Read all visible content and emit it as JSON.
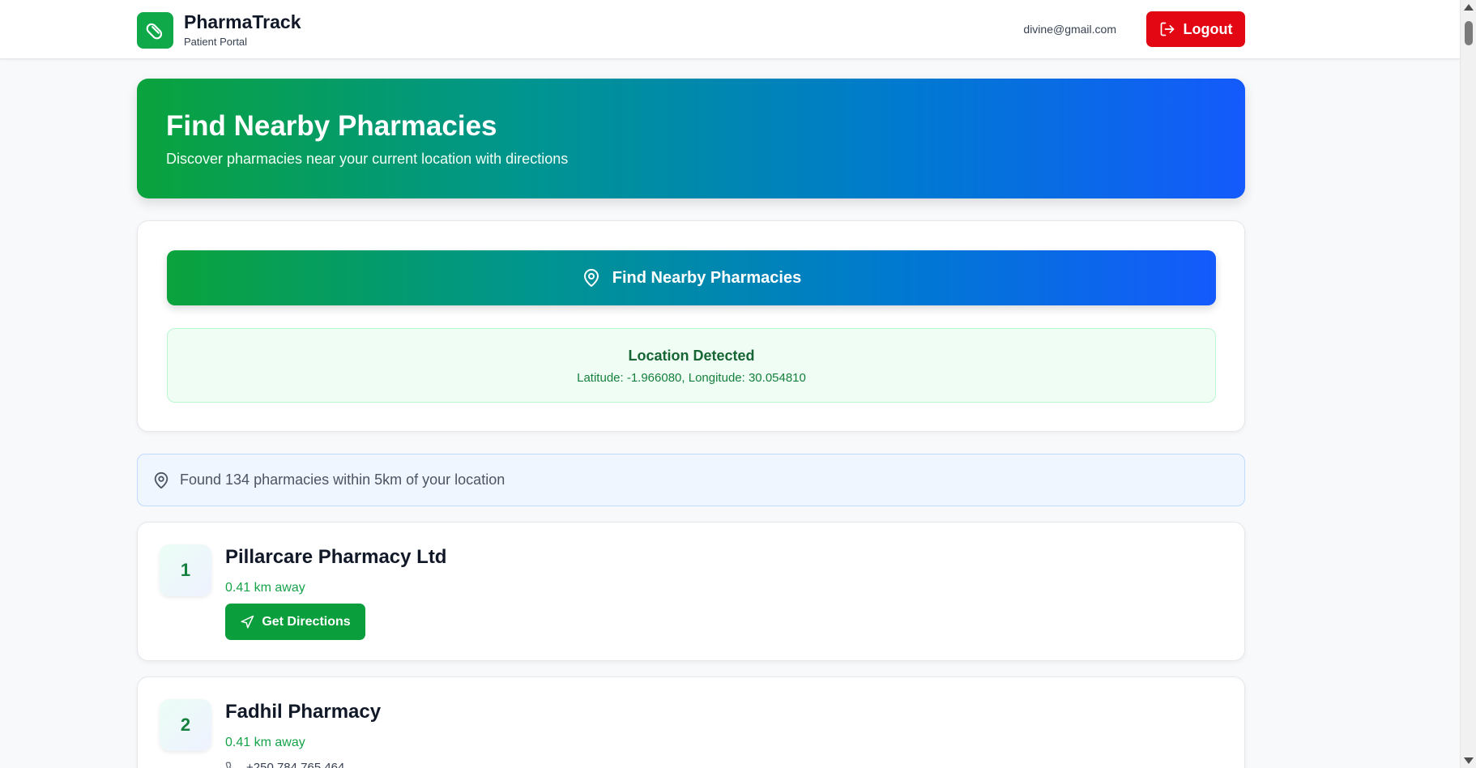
{
  "header": {
    "app_name": "PharmaTrack",
    "app_subtitle": "Patient Portal",
    "user_email": "divine@gmail.com",
    "logout_label": "Logout",
    "logo_icon": "pill-icon"
  },
  "hero": {
    "title": "Find Nearby Pharmacies",
    "subtitle": "Discover pharmacies near your current location with directions"
  },
  "finder": {
    "button_label": "Find Nearby Pharmacies",
    "location_title": "Location Detected",
    "location_coords": "Latitude: -1.966080, Longitude: 30.054810"
  },
  "results": {
    "summary": "Found 134 pharmacies within 5km of your location"
  },
  "pharmacies": [
    {
      "rank": "1",
      "name": "Pillarcare Pharmacy Ltd",
      "distance": "0.41 km away",
      "action_label": "Get Directions"
    },
    {
      "rank": "2",
      "name": "Fadhil Pharmacy",
      "distance": "0.41 km away",
      "phone": "+250 784 765 464"
    }
  ],
  "colors": {
    "brand_green": "#10a94a",
    "gradient_start": "#0aa33c",
    "gradient_end": "#145afc",
    "logout_red": "#e30613"
  }
}
